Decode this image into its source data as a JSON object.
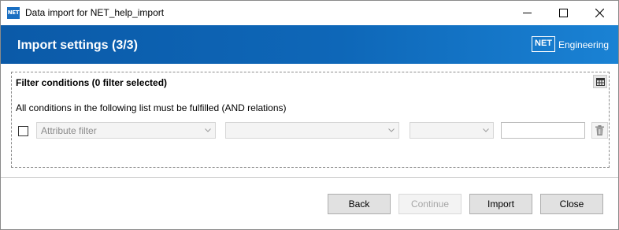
{
  "window": {
    "app_icon_text": "NET",
    "title": "Data import for NET_help_import"
  },
  "banner": {
    "title": "Import settings (3/3)",
    "brand_logo": "NET",
    "brand_text": "Engineering",
    "gradient_colors": [
      "#0b5aa8",
      "#1a82d4"
    ]
  },
  "filter": {
    "group_title": "Filter conditions (0 filter selected)",
    "hint": "All conditions in the following list must be fulfilled (AND relations)",
    "rows": [
      {
        "checked": false,
        "attribute_placeholder": "Attribute filter",
        "operator_value": "",
        "condition_value": "",
        "value_input": ""
      }
    ]
  },
  "footer": {
    "back_label": "Back",
    "continue_label": "Continue",
    "import_label": "Import",
    "close_label": "Close"
  },
  "icons": {
    "table_settings": "table-icon",
    "delete": "trash-icon",
    "dropdown": "chevron-down-icon"
  }
}
